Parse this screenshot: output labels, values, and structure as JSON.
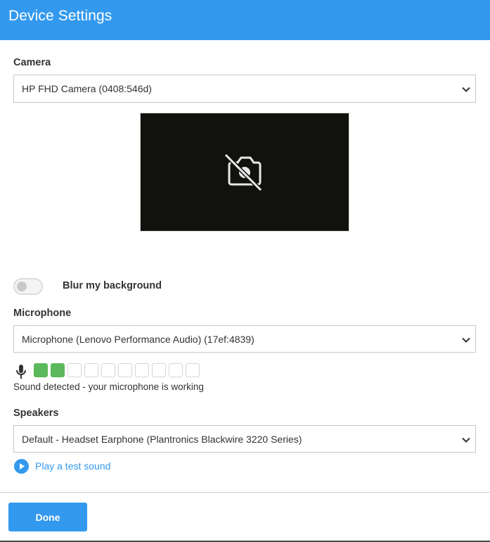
{
  "header": {
    "title": "Device Settings"
  },
  "camera": {
    "label": "Camera",
    "selected": "HP FHD Camera (0408:546d)",
    "preview_icon": "camera-off-icon"
  },
  "blur": {
    "label": "Blur my background",
    "enabled": false
  },
  "microphone": {
    "label": "Microphone",
    "selected": "Microphone (Lenovo Performance Audio) (17ef:4839)",
    "level_active_cells": 2,
    "level_total_cells": 10,
    "status": "Sound detected - your microphone is working"
  },
  "speakers": {
    "label": "Speakers",
    "selected": "Default - Headset Earphone (Plantronics Blackwire 3220 Series)",
    "test_label": "Play a test sound"
  },
  "footer": {
    "done_label": "Done"
  },
  "colors": {
    "accent": "#3399ee",
    "level_on": "#5cb85c",
    "preview_bg": "#11110d"
  }
}
